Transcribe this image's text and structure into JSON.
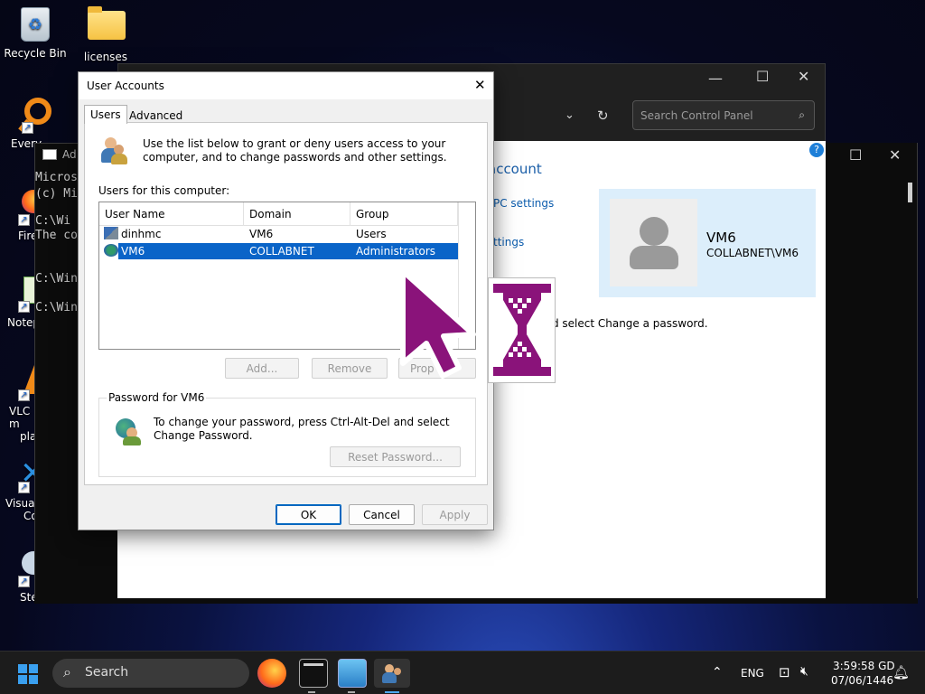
{
  "desktop": {
    "icons": [
      {
        "label": "Recycle Bin"
      },
      {
        "label": "licenses"
      },
      {
        "label": "Every"
      },
      {
        "label": "Fire"
      },
      {
        "label": "Notep"
      },
      {
        "label": "VLC m"
      },
      {
        "label": "pla"
      },
      {
        "label": "Visual"
      },
      {
        "label": "Co"
      },
      {
        "label": "Ste"
      }
    ]
  },
  "control_panel": {
    "search_placeholder": "Search Control Panel",
    "heading": "account",
    "link1": "PC settings",
    "link2": "ttings",
    "user_name": "VM6",
    "user_domain": "COLLABNET\\VM6",
    "hint": "and select Change a password."
  },
  "cmd": {
    "title": "Ad",
    "lines": [
      "Micros",
      "(c) Mi",
      "C:\\Wi",
      "The co",
      "C:\\Win",
      "C:\\Win"
    ]
  },
  "dialog": {
    "title": "User Accounts",
    "tabs": [
      "Users",
      "Advanced"
    ],
    "intro": "Use the list below to grant or deny users access to your computer, and to change passwords and other settings.",
    "list_label": "Users for this computer:",
    "columns": [
      "User Name",
      "Domain",
      "Group"
    ],
    "rows": [
      {
        "user": "dinhmc",
        "domain": "VM6",
        "group": "Users"
      },
      {
        "user": "VM6",
        "domain": "COLLABNET",
        "group": "Administrators"
      }
    ],
    "buttons": {
      "add": "Add...",
      "remove": "Remove",
      "properties": "Prop"
    },
    "password_group": "Password for VM6",
    "password_text": "To change your password, press Ctrl-Alt-Del and select Change Password.",
    "reset_password": "Reset Password...",
    "ok": "OK",
    "cancel": "Cancel",
    "apply": "Apply"
  },
  "taskbar": {
    "search_label": "Search",
    "language": "ENG",
    "time": "3:59:58 GD",
    "date": "07/06/1446"
  },
  "colors": {
    "selection": "#0a64c8",
    "cursor_purple": "#8a137a",
    "profile_bg": "#dceefb"
  }
}
